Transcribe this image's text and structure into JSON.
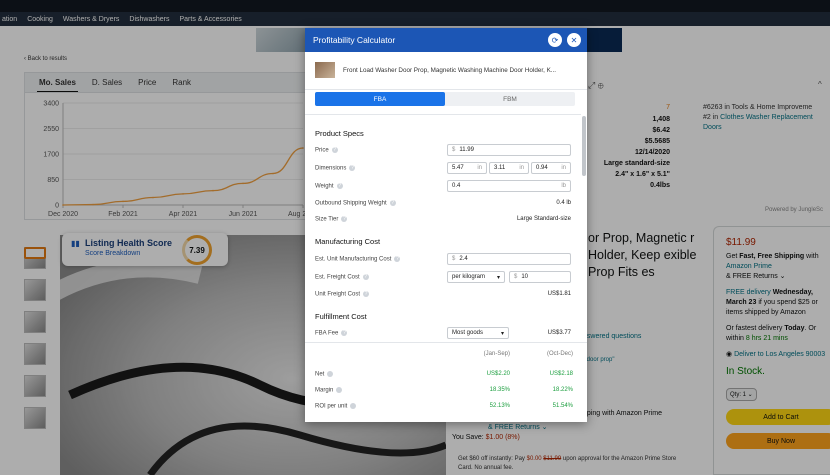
{
  "nav": {
    "items": [
      "ation",
      "Cooking",
      "Washers & Dryers",
      "Dishwashers",
      "Parts & Accessories"
    ]
  },
  "back_link": "‹ Back to results",
  "jungle_panel": {
    "tabs": [
      "Mo. Sales",
      "D. Sales",
      "Price",
      "Rank"
    ],
    "active_tab": "Mo. Sales",
    "stats": [
      "7",
      "1,408",
      "$6.42",
      "$5.5685",
      "12/14/2020",
      "Large standard-size",
      "2.4\" x 1.6\" x 5.1\"",
      "0.4lbs"
    ],
    "rank_text": [
      "#6263 in Tools & Home Improveme",
      "#2 in",
      "Clothes Washer Replacement",
      "Doors"
    ],
    "powered_by": "Powered by JungleSc"
  },
  "chart_data": {
    "type": "line",
    "title": "",
    "x": [
      "Dec 2020",
      "Jan 2021",
      "Feb 2021",
      "Mar 2021",
      "Apr 2021",
      "May 2021",
      "Jun 2021",
      "Jul 2021",
      "Aug 2021"
    ],
    "xticks": [
      "Dec 2020",
      "Feb 2021",
      "Apr 2021",
      "Jun 2021",
      "Aug 2021"
    ],
    "yticks": [
      "3400",
      "2550",
      "1700",
      "850",
      "0"
    ],
    "ylim": [
      0,
      3400
    ],
    "series": [
      {
        "values": [
          0,
          15,
          120,
          250,
          370,
          480,
          720,
          1050,
          1900
        ]
      }
    ],
    "grid": true,
    "color": "#f0a040"
  },
  "listing_health": {
    "title": "Listing Health Score",
    "subtitle": "Score Breakdown",
    "score": "7.39"
  },
  "product": {
    "title": "or Prop, Magnetic r Holder, Keep exible Prop Fits es",
    "answered": "nswered questions",
    "choice": "r door prop\"",
    "prime": "pping with Amazon Prime",
    "returns": "& FREE Returns ⌄",
    "save_label": "You Save:",
    "save_value": "$1.00 (8%)",
    "card_offer": "Get $60 off instantly: Pay $0.00 $11.99 upon approval for the Amazon Prime Store Card. No annual fee.",
    "card_prefix": "Get $60 off instantly: Pay ",
    "card_price": "$0.00",
    "card_strike": "$11.99",
    "card_suffix": " upon approval for the Amazon Prime Store Card. No annual fee."
  },
  "buybox": {
    "price": "$11.99",
    "shipping_1": "Get",
    "shipping_bold": "Fast, Free Shipping",
    "shipping_2": "with",
    "prime": "Amazon Prime",
    "returns": "& FREE Returns ⌄",
    "delivery_1": "FREE delivery",
    "delivery_day": "Wednesday, March 23",
    "delivery_2": "if you spend $25 or",
    "delivery_3": "items shipped by Amazon",
    "fastest_1": "Or fastest delivery",
    "fastest_day": "Today",
    "fastest_2": ". Or",
    "fastest_3": "within",
    "fastest_time": "8 hrs 21 mins",
    "deliver_to": "Deliver to Los Angeles 90003",
    "stock": "In Stock.",
    "qty": "Qty: 1 ⌄",
    "add_to_cart": "Add to Cart",
    "buy_now": "Buy Now"
  },
  "calculator": {
    "title": "Profitability Calculator",
    "product_name": "Front Load Washer Door Prop, Magnetic Washing Machine Door Holder, K...",
    "tabs": [
      "FBA",
      "FBM"
    ],
    "active_tab": "FBA",
    "product_specs": {
      "title": "Product Specs",
      "price_label": "Price",
      "price_currency": "$",
      "price_value": "11.99",
      "dimensions_label": "Dimensions",
      "dim_1": "5.47",
      "dim_2": "3.11",
      "dim_3": "0.94",
      "dim_unit": "in",
      "weight_label": "Weight",
      "weight_value": "0.4",
      "weight_unit": "lb",
      "outbound_label": "Outbound Shipping Weight",
      "outbound_value": "0.4 lb",
      "size_label": "Size Tier",
      "size_value": "Large Standard-size"
    },
    "manufacturing": {
      "title": "Manufacturing Cost",
      "unit_label": "Est. Unit Manufacturing Cost",
      "unit_currency": "$",
      "unit_value": "2.4",
      "freight_label": "Est. Freight Cost",
      "freight_unit": "per kilogram",
      "freight_currency": "$",
      "freight_value": "10",
      "unit_freight_label": "Unit Freight Cost",
      "unit_freight_value": "US$1.81"
    },
    "fulfillment": {
      "title": "Fulfillment Cost",
      "fba_fee_label": "FBA Fee",
      "fba_fee_option": "Most goods",
      "fba_fee_value": "US$3.77"
    },
    "footer": {
      "col_1": "(Jan-Sep)",
      "col_2": "(Oct-Dec)",
      "rows": [
        {
          "label": "Net",
          "v1": "US$2.20",
          "v2": "US$2.18"
        },
        {
          "label": "Margin",
          "v1": "18.35%",
          "v2": "18.22%"
        },
        {
          "label": "ROI per unit",
          "v1": "52.13%",
          "v2": "51.54%"
        }
      ]
    }
  }
}
